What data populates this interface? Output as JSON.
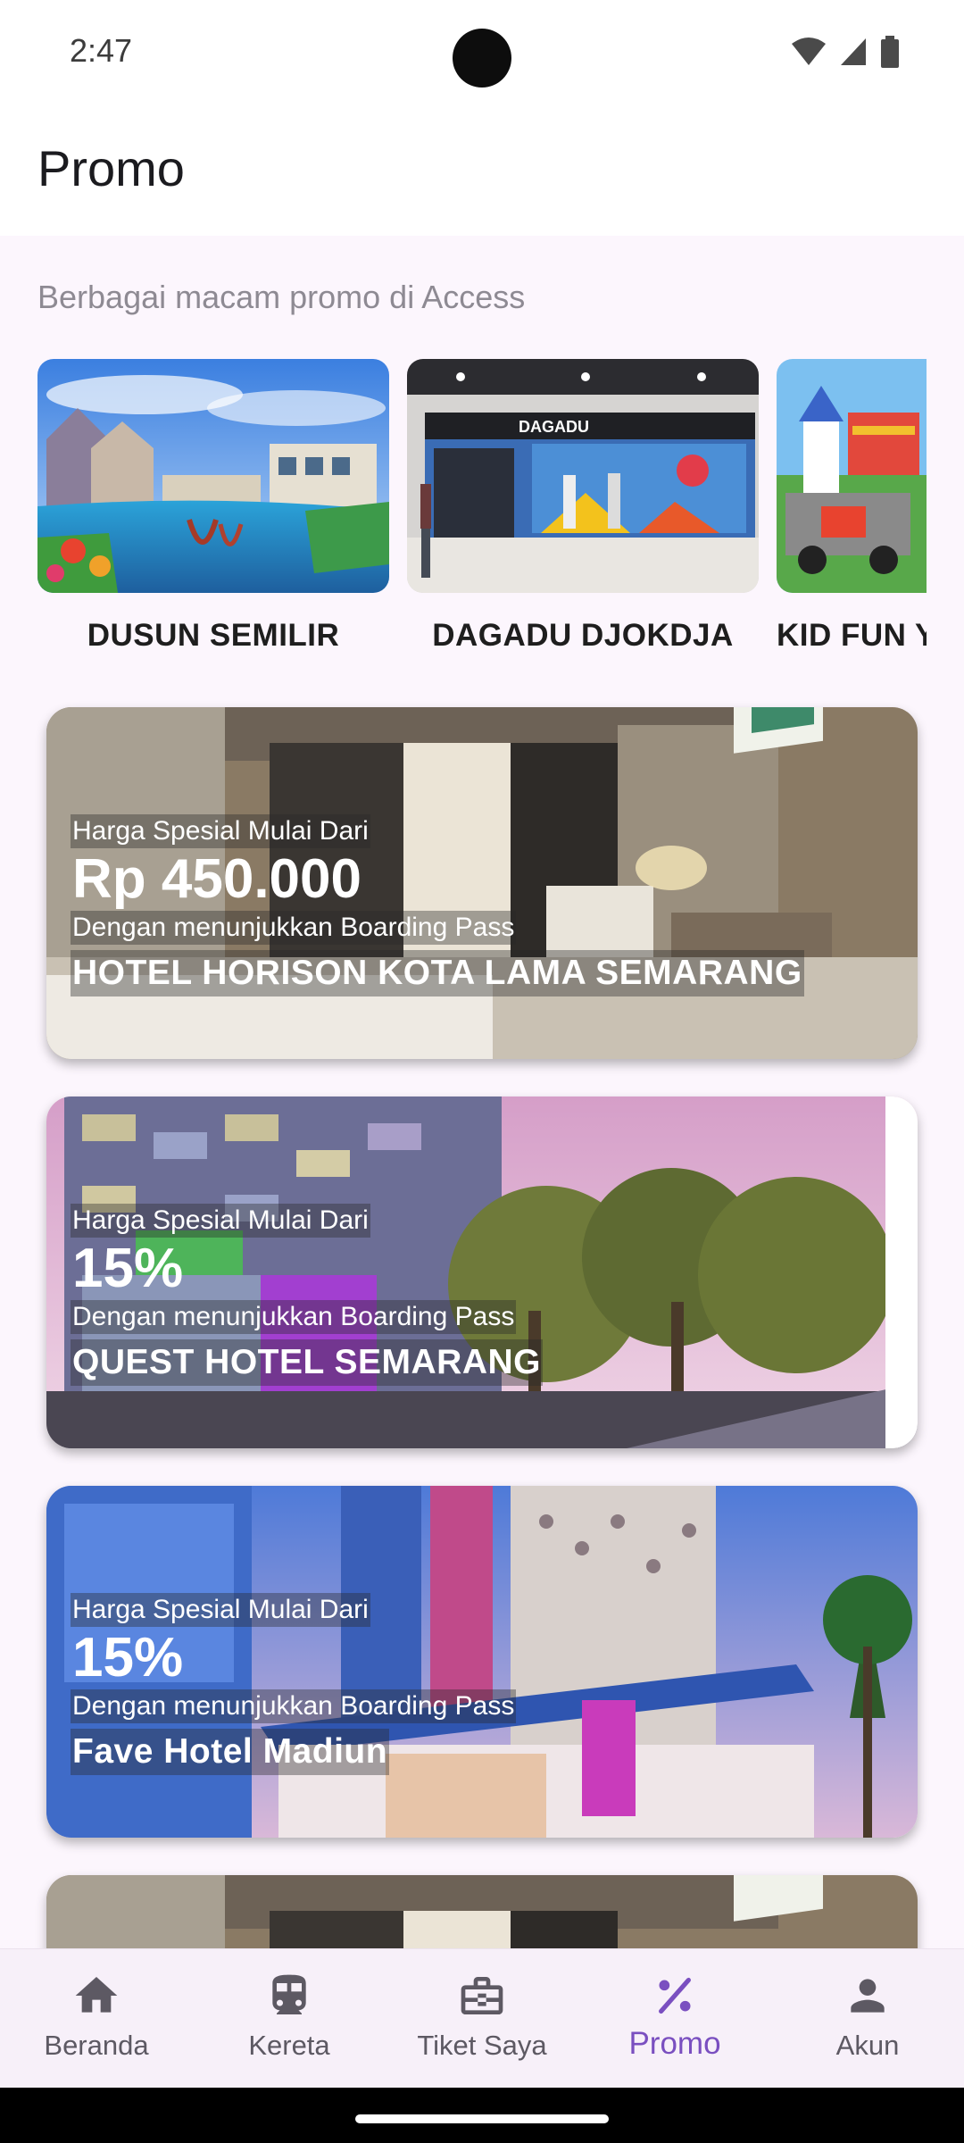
{
  "status_bar": {
    "time": "2:47"
  },
  "app_bar": {
    "title": "Promo"
  },
  "content": {
    "subtitle": "Berbagai macam promo di Access",
    "carousel": [
      {
        "label": "DUSUN SEMILIR"
      },
      {
        "label": "DAGADU DJOKDJA"
      },
      {
        "label": "KID FUN Y"
      }
    ],
    "promos": [
      {
        "caption": "Harga Spesial Mulai Dari",
        "price": "Rp 450.000",
        "condition": "Dengan menunjukkan Boarding Pass",
        "name": "HOTEL HORISON KOTA LAMA SEMARANG"
      },
      {
        "caption": "Harga Spesial Mulai Dari",
        "price": "15%",
        "condition": "Dengan menunjukkan Boarding Pass",
        "name": "QUEST HOTEL SEMARANG"
      },
      {
        "caption": "Harga Spesial Mulai Dari",
        "price": "15%",
        "condition": "Dengan menunjukkan Boarding Pass",
        "name": "Fave Hotel Madiun"
      }
    ]
  },
  "bottom_nav": {
    "items": [
      {
        "label": "Beranda",
        "icon": "home-icon"
      },
      {
        "label": "Kereta",
        "icon": "train-icon"
      },
      {
        "label": "Tiket Saya",
        "icon": "briefcase-icon"
      },
      {
        "label": "Promo",
        "icon": "percent-icon",
        "active": true
      },
      {
        "label": "Akun",
        "icon": "person-icon"
      }
    ],
    "active_color": "#7a4fc0"
  }
}
